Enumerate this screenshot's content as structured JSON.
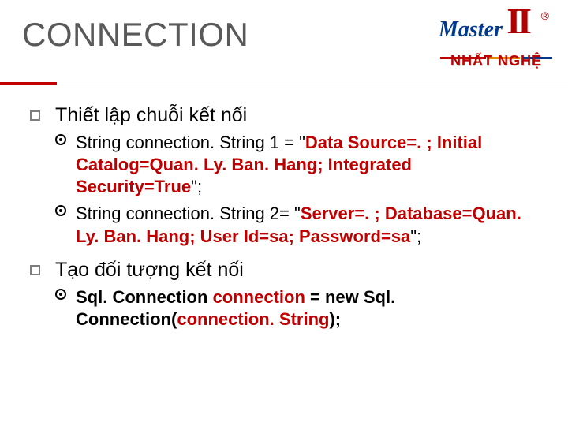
{
  "title": "CONNECTION",
  "logo": {
    "master_text": "Master",
    "ii": "II",
    "reg": "®",
    "brand": "NHẤT NGHỆ"
  },
  "section1": {
    "heading": "Thiết lập chuỗi kết nối",
    "item1": {
      "prefix": "String connection. String 1 = \"",
      "highlight": "Data Source=. ; Initial Catalog=Quan. Ly. Ban. Hang; Integrated Security=True",
      "suffix": "\";"
    },
    "item2": {
      "prefix": "String connection. String 2= \"",
      "highlight": "Server=. ; Database=Quan. Ly. Ban. Hang; User Id=sa; Password=sa",
      "suffix": "\";"
    }
  },
  "section2": {
    "heading": "Tạo đối tượng kết nối",
    "item1": {
      "p1": "Sql. Connection",
      "p2": " connection ",
      "p3": "= new",
      "p4": " Sql. Connection(",
      "p5": "connection. String",
      "p6": ");"
    }
  }
}
